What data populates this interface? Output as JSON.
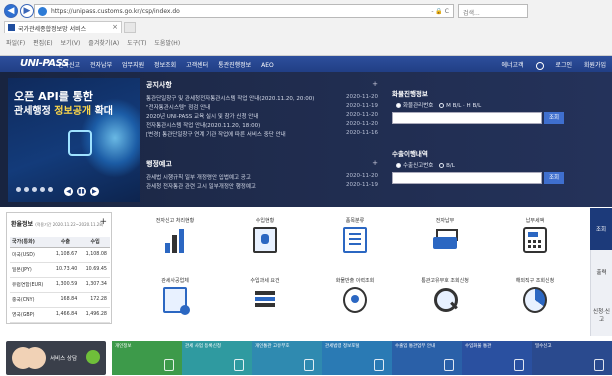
{
  "browser": {
    "url": "https://unipass.customs.go.kr/csp/index.do",
    "addr_tools": "- 🔒 C",
    "search_placeholder": "검색...",
    "tab_title": "국가관세종합정보망 서비스",
    "tab_close": "×",
    "menu": [
      "파일(F)",
      "편집(E)",
      "보기(V)",
      "즐겨찾기(A)",
      "도구(T)",
      "도움말(H)"
    ]
  },
  "site": {
    "logo": "UNI-PASS",
    "gnb": [
      "전자신고",
      "전자납부",
      "업무지원",
      "정보조회",
      "고객센터",
      "통관진행정보",
      "AEO"
    ],
    "header_right": [
      "에너고객",
      "로그인",
      "회원가입"
    ]
  },
  "banner": {
    "line1": "오픈 API를 통한",
    "line2_a": "관세행정 ",
    "line2_b": "정보공개",
    "line2_c": " 확대",
    "controls": [
      "◀",
      "▮▮",
      "▶"
    ]
  },
  "notices": {
    "title": "공지사항",
    "more": "+",
    "items": [
      {
        "text": "통관단일창구 및 관세청전자통관시스템 작업 안내(2020.11.20, 20:00)",
        "date": "2020-11-20"
      },
      {
        "text": "\"전자통관시스템\" 점검 안내",
        "date": "2020-11-19"
      },
      {
        "text": "2020년 UNI-PASS 교육 실시 및 참가 신청 안내",
        "date": "2020-11-20"
      },
      {
        "text": "전자통관시스템 작업 안내(2020.11.20, 18:00)",
        "date": "2020-11-20"
      },
      {
        "text": "[변경] 통관단일창구 연계 기관 작업에 따른 서비스 중단 안내",
        "date": "2020-11-16"
      }
    ]
  },
  "guides": {
    "title": "행정예고",
    "more": "+",
    "items": [
      {
        "text": "관세법 시행규칙 일부 개정령안 입법예고 공고",
        "date": "2020-11-20"
      },
      {
        "text": "관세청 전자통관 관련 고시 일부개정안 행정예고",
        "date": "2020-11-19"
      }
    ]
  },
  "cargo_search": {
    "title": "화물진행정보",
    "options": [
      "화물관리번호",
      "M B/L · H B/L"
    ],
    "button": "조회"
  },
  "import_search": {
    "title": "수출이행내역",
    "options": [
      "수출신고번호",
      "B/L"
    ],
    "button": "조회"
  },
  "fx": {
    "title": "환율정보",
    "note": "(적용기간 2020.11.22~2020.11.28)",
    "more": "+",
    "columns": [
      "국가(통화)",
      "수출",
      "수입"
    ],
    "rows": [
      [
        "미국(USD)",
        "1,108.67",
        "1,108.08"
      ],
      [
        "일본(JPY)",
        "10.73.40",
        "10.69.45"
      ],
      [
        "유럽연합(EUR)",
        "1,300.59",
        "1,307.34"
      ],
      [
        "중국(CNY)",
        "168.84",
        "172.28"
      ],
      [
        "영국(GBP)",
        "1,466.84",
        "1,496.28"
      ]
    ]
  },
  "services": [
    {
      "label": "전자신고 처리현황",
      "icon": "bar-chart-icon"
    },
    {
      "label": "수입현황",
      "icon": "monitor-icon"
    },
    {
      "label": "품목분류",
      "icon": "document-icon"
    },
    {
      "label": "전자납부",
      "icon": "printer-icon"
    },
    {
      "label": "납부세액",
      "icon": "calculator-icon"
    },
    {
      "label": "관세사공업체",
      "icon": "book-search-icon"
    },
    {
      "label": "수입과세 요건",
      "icon": "layers-icon"
    },
    {
      "label": "화물반출 이력조회",
      "icon": "coin-icon"
    },
    {
      "label": "통관고유부호 조회신청",
      "icon": "magnifier-icon"
    },
    {
      "label": "해외직구 조회신청",
      "icon": "pie-chart-icon"
    }
  ],
  "side_tabs": [
    "조회",
    "출력",
    "신청·신고"
  ],
  "help": {
    "label": "서비스 상담"
  },
  "quick": [
    {
      "label": "개인정보",
      "color": "#3d9a4a"
    },
    {
      "label": "관세 사업 등록신청",
      "color": "#2f9aa0"
    },
    {
      "label": "개인통관 고유부호",
      "color": "#2f8ab0"
    },
    {
      "label": "관세법령 정보포털",
      "color": "#2a7ab4"
    },
    {
      "label": "수출입 통관업무 안내",
      "color": "#2a60a8"
    },
    {
      "label": "수입화물 통관",
      "color": "#2a50a0"
    },
    {
      "label": "밀수신고",
      "color": "#2a4a8e"
    }
  ],
  "colors": {
    "header": "#213f85",
    "accent": "#2b67c2",
    "dark": "#1c3a7a"
  }
}
